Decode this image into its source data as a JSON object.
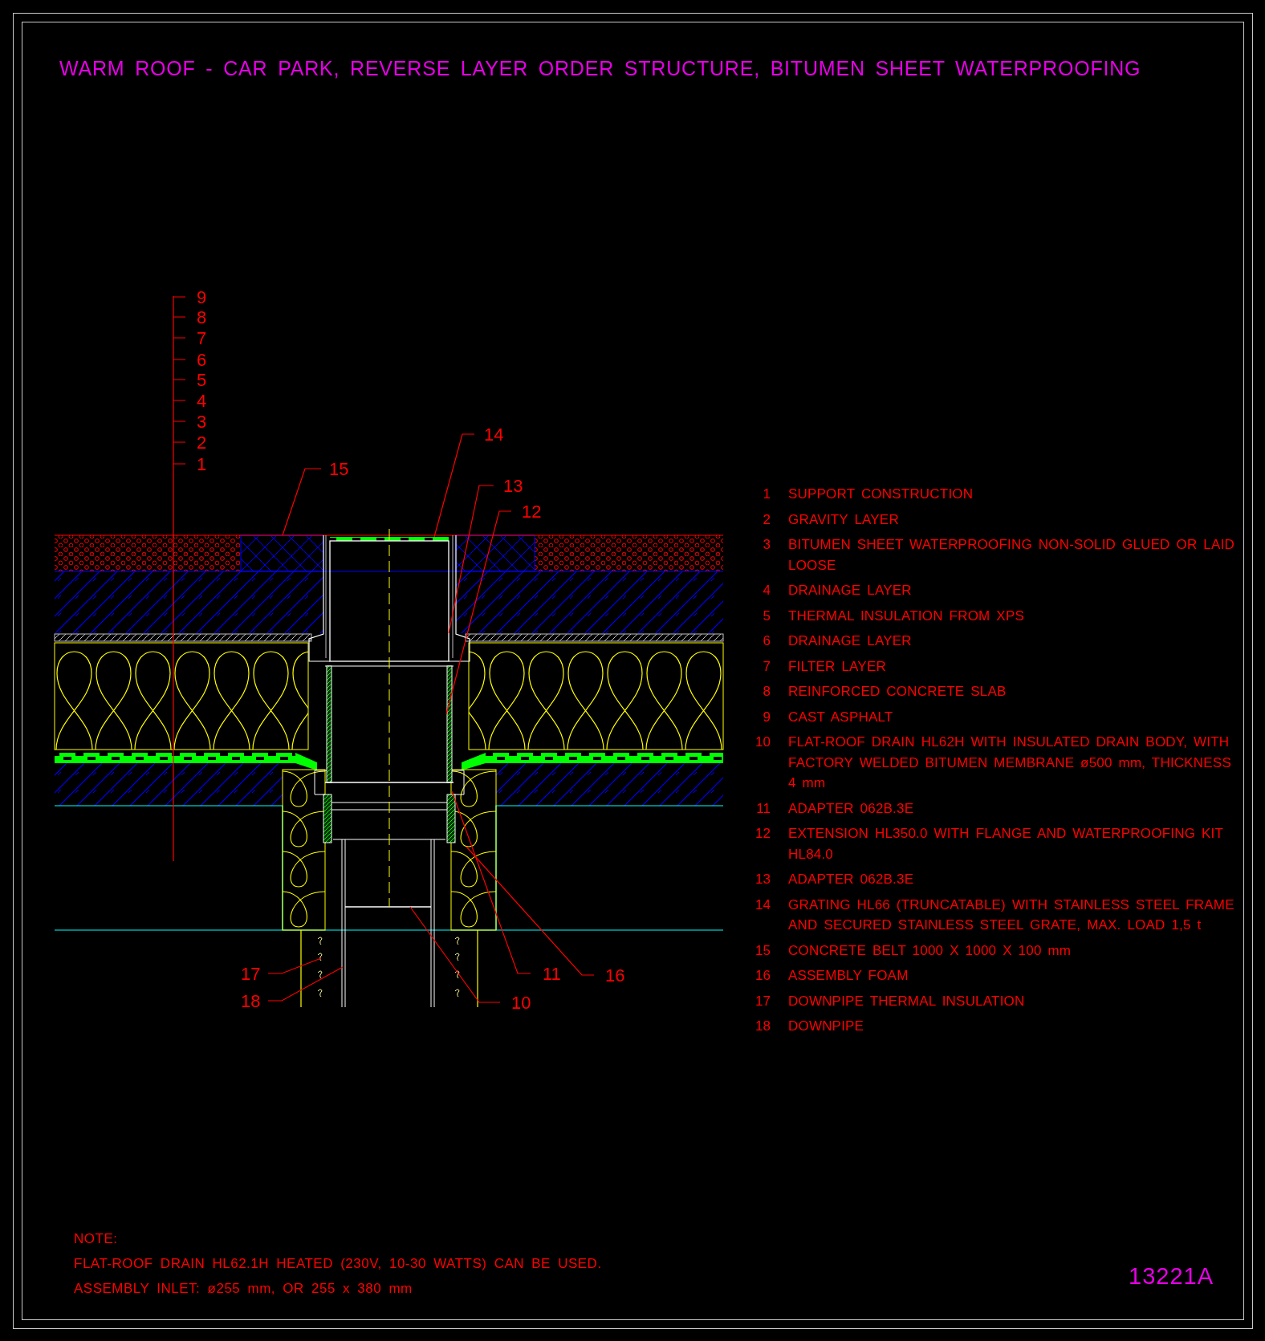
{
  "title": "WARM ROOF - CAR PARK, REVERSE LAYER ORDER STRUCTURE, BITUMEN SHEET WATERPROOFING",
  "layer_scale": [
    "9",
    "8",
    "7",
    "6",
    "5",
    "4",
    "3",
    "2",
    "1"
  ],
  "callouts": [
    "14",
    "15",
    "13",
    "12",
    "11",
    "16",
    "10",
    "17",
    "18"
  ],
  "legend": [
    {
      "number": "1",
      "text": "SUPPORT CONSTRUCTION"
    },
    {
      "number": "2",
      "text": "GRAVITY LAYER"
    },
    {
      "number": "3",
      "text": "BITUMEN SHEET WATERPROOFING NON-SOLID GLUED OR LAID LOOSE"
    },
    {
      "number": "4",
      "text": "DRAINAGE LAYER"
    },
    {
      "number": "5",
      "text": "THERMAL INSULATION FROM XPS"
    },
    {
      "number": "6",
      "text": "DRAINAGE LAYER"
    },
    {
      "number": "7",
      "text": "FILTER LAYER"
    },
    {
      "number": "8",
      "text": "REINFORCED CONCRETE SLAB"
    },
    {
      "number": "9",
      "text": "CAST ASPHALT"
    },
    {
      "number": "10",
      "text": "FLAT-ROOF DRAIN HL62H WITH INSULATED DRAIN BODY, WITH FACTORY WELDED BITUMEN MEMBRANE ø500 mm, THICKNESS 4 mm"
    },
    {
      "number": "11",
      "text": "ADAPTER 062B.3E"
    },
    {
      "number": "12",
      "text": "EXTENSION HL350.0 WITH FLANGE AND WATERPROOFING KIT HL84.0"
    },
    {
      "number": "13",
      "text": "ADAPTER 062B.3E"
    },
    {
      "number": "14",
      "text": "GRATING HL66 (TRUNCATABLE) WITH STAINLESS STEEL FRAME AND SECURED STAINLESS STEEL GRATE, MAX. LOAD 1,5 t"
    },
    {
      "number": "15",
      "text": "CONCRETE BELT 1000 X 1000 X 100 mm"
    },
    {
      "number": "16",
      "text": "ASSEMBLY FOAM"
    },
    {
      "number": "17",
      "text": "DOWNPIPE THERMAL INSULATION"
    },
    {
      "number": "18",
      "text": "DOWNPIPE"
    }
  ],
  "note": {
    "heading": "NOTE:",
    "lines": [
      "FLAT-ROOF DRAIN HL62.1H HEATED (230V, 10-30 WATTS) CAN BE USED.",
      "ASSEMBLY INLET: ø255 mm, OR 255 x 380 mm"
    ]
  },
  "drawing_number": "13221A"
}
